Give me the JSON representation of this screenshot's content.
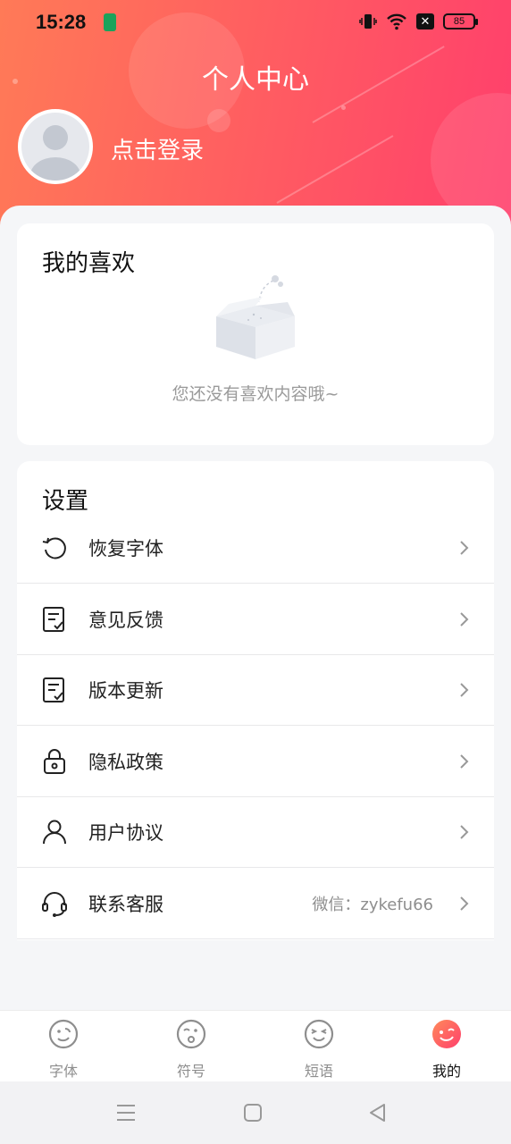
{
  "status_bar": {
    "time": "15:28",
    "battery": "85"
  },
  "header": {
    "title": "个人中心",
    "login": "点击登录"
  },
  "favorites": {
    "title": "我的喜欢",
    "empty_text": "您还没有喜欢内容哦~"
  },
  "settings": {
    "title": "设置",
    "items": [
      {
        "label": "恢复字体",
        "icon": "restore-icon"
      },
      {
        "label": "意见反馈",
        "icon": "feedback-icon"
      },
      {
        "label": "版本更新",
        "icon": "update-icon"
      },
      {
        "label": "隐私政策",
        "icon": "lock-icon"
      },
      {
        "label": "用户协议",
        "icon": "user-icon"
      },
      {
        "label": "联系客服",
        "icon": "headset-icon",
        "extra": "微信：zykefu66"
      }
    ]
  },
  "tabs": [
    {
      "label": "字体",
      "icon": "font-face-icon",
      "active": false
    },
    {
      "label": "符号",
      "icon": "symbol-face-icon",
      "active": false
    },
    {
      "label": "短语",
      "icon": "phrase-face-icon",
      "active": false
    },
    {
      "label": "我的",
      "icon": "mine-face-icon",
      "active": true
    }
  ],
  "colors": {
    "header_start": "#ff7a57",
    "header_end": "#ff3f6c",
    "active_tab": "#ff4f68"
  }
}
